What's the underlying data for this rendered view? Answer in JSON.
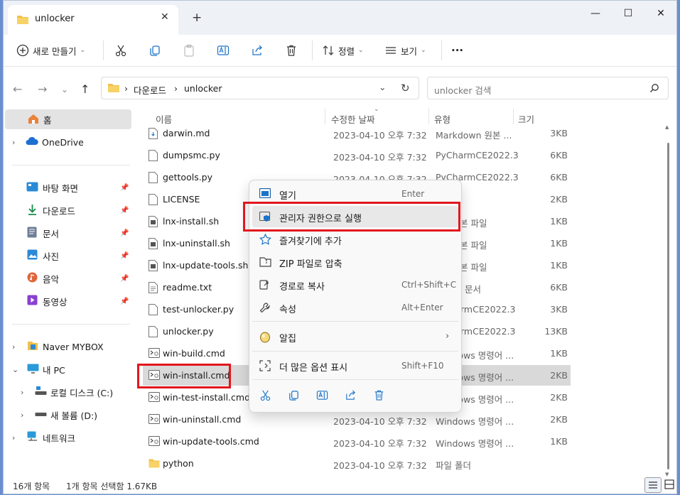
{
  "window": {
    "tab_title": "unlocker",
    "new_tab": "+",
    "controls": {
      "minimize": "—",
      "maximize": "☐",
      "close": "✕"
    }
  },
  "toolbar": {
    "new_label": "새로 만들기",
    "sort_label": "정렬",
    "view_label": "보기",
    "more_label": "···"
  },
  "address": {
    "crumbs": [
      "다운로드",
      "unlocker"
    ],
    "separator": "›",
    "search_placeholder": "unlocker 검색"
  },
  "sidebar": {
    "home": "홈",
    "onedrive": "OneDrive",
    "quick": [
      "바탕 화면",
      "다운로드",
      "문서",
      "사진",
      "음악",
      "동영상"
    ],
    "mybox": "Naver MYBOX",
    "pc": "내 PC",
    "drive_c": "로컬 디스크 (C:)",
    "drive_d": "새 볼륨 (D:)",
    "network": "네트워크"
  },
  "columns": {
    "name": "이름",
    "date": "수정한 날짜",
    "type": "유형",
    "size": "크기"
  },
  "files": [
    {
      "name": "darwin.md",
      "date": "2023-04-10 오후 7:32",
      "type": "Markdown 원본 ...",
      "size": "3KB"
    },
    {
      "name": "dumpsmc.py",
      "date": "2023-04-10 오후 7:32",
      "type": "PyCharmCE2022.3",
      "size": "6KB"
    },
    {
      "name": "gettools.py",
      "date": "2023-04-10 오후 7:32",
      "type": "PyCharmCE2022.3",
      "size": "6KB"
    },
    {
      "name": "LICENSE",
      "date": "",
      "type": "",
      "size": "2KB"
    },
    {
      "name": "lnx-install.sh",
      "date": "",
      "type": "본 파일",
      "size": "1KB"
    },
    {
      "name": "lnx-uninstall.sh",
      "date": "",
      "type": "본 파일",
      "size": "1KB"
    },
    {
      "name": "lnx-update-tools.sh",
      "date": "",
      "type": "본 파일",
      "size": "1KB"
    },
    {
      "name": "readme.txt",
      "date": "",
      "type": "문서",
      "size": "6KB"
    },
    {
      "name": "test-unlocker.py",
      "date": "",
      "type": "rmCE2022.3",
      "size": "3KB"
    },
    {
      "name": "unlocker.py",
      "date": "",
      "type": "rmCE2022.3",
      "size": "13KB"
    },
    {
      "name": "win-build.cmd",
      "date": "",
      "type": "Windows 명령어 ...",
      "size": "1KB"
    },
    {
      "name": "win-install.cmd",
      "date": "",
      "type": "Windows 명령어 ...",
      "size": "2KB"
    },
    {
      "name": "win-test-install.cmd",
      "date": "",
      "type": "Windows 명령어 ...",
      "size": "2KB"
    },
    {
      "name": "win-uninstall.cmd",
      "date": "2023-04-10 오후 7:32",
      "type": "Windows 명령어 ...",
      "size": "2KB"
    },
    {
      "name": "win-update-tools.cmd",
      "date": "2023-04-10 오후 7:32",
      "type": "Windows 명령어 ...",
      "size": "1KB"
    },
    {
      "name": "python",
      "date": "2023-04-10 오후 7:32",
      "type": "파일 폴더",
      "size": ""
    }
  ],
  "context_menu": {
    "open": {
      "label": "열기",
      "shortcut": "Enter"
    },
    "run_as_admin": {
      "label": "관리자 권한으로 실행"
    },
    "favorites": {
      "label": "즐겨찾기에 추가"
    },
    "zip": {
      "label": "ZIP 파일로 압축"
    },
    "copy_path": {
      "label": "경로로 복사",
      "shortcut": "Ctrl+Shift+C"
    },
    "properties": {
      "label": "속성",
      "shortcut": "Alt+Enter"
    },
    "alzip": {
      "label": "알집",
      "arrow": "›"
    },
    "more_options": {
      "label": "더 많은 옵션 표시",
      "shortcut": "Shift+F10"
    }
  },
  "status": {
    "count": "16개 항목",
    "selection": "1개 항목 선택함 1.67KB"
  },
  "colors": {
    "highlight": "#e3161e",
    "accent": "#1a73c8",
    "folder": "#f2c04a"
  }
}
